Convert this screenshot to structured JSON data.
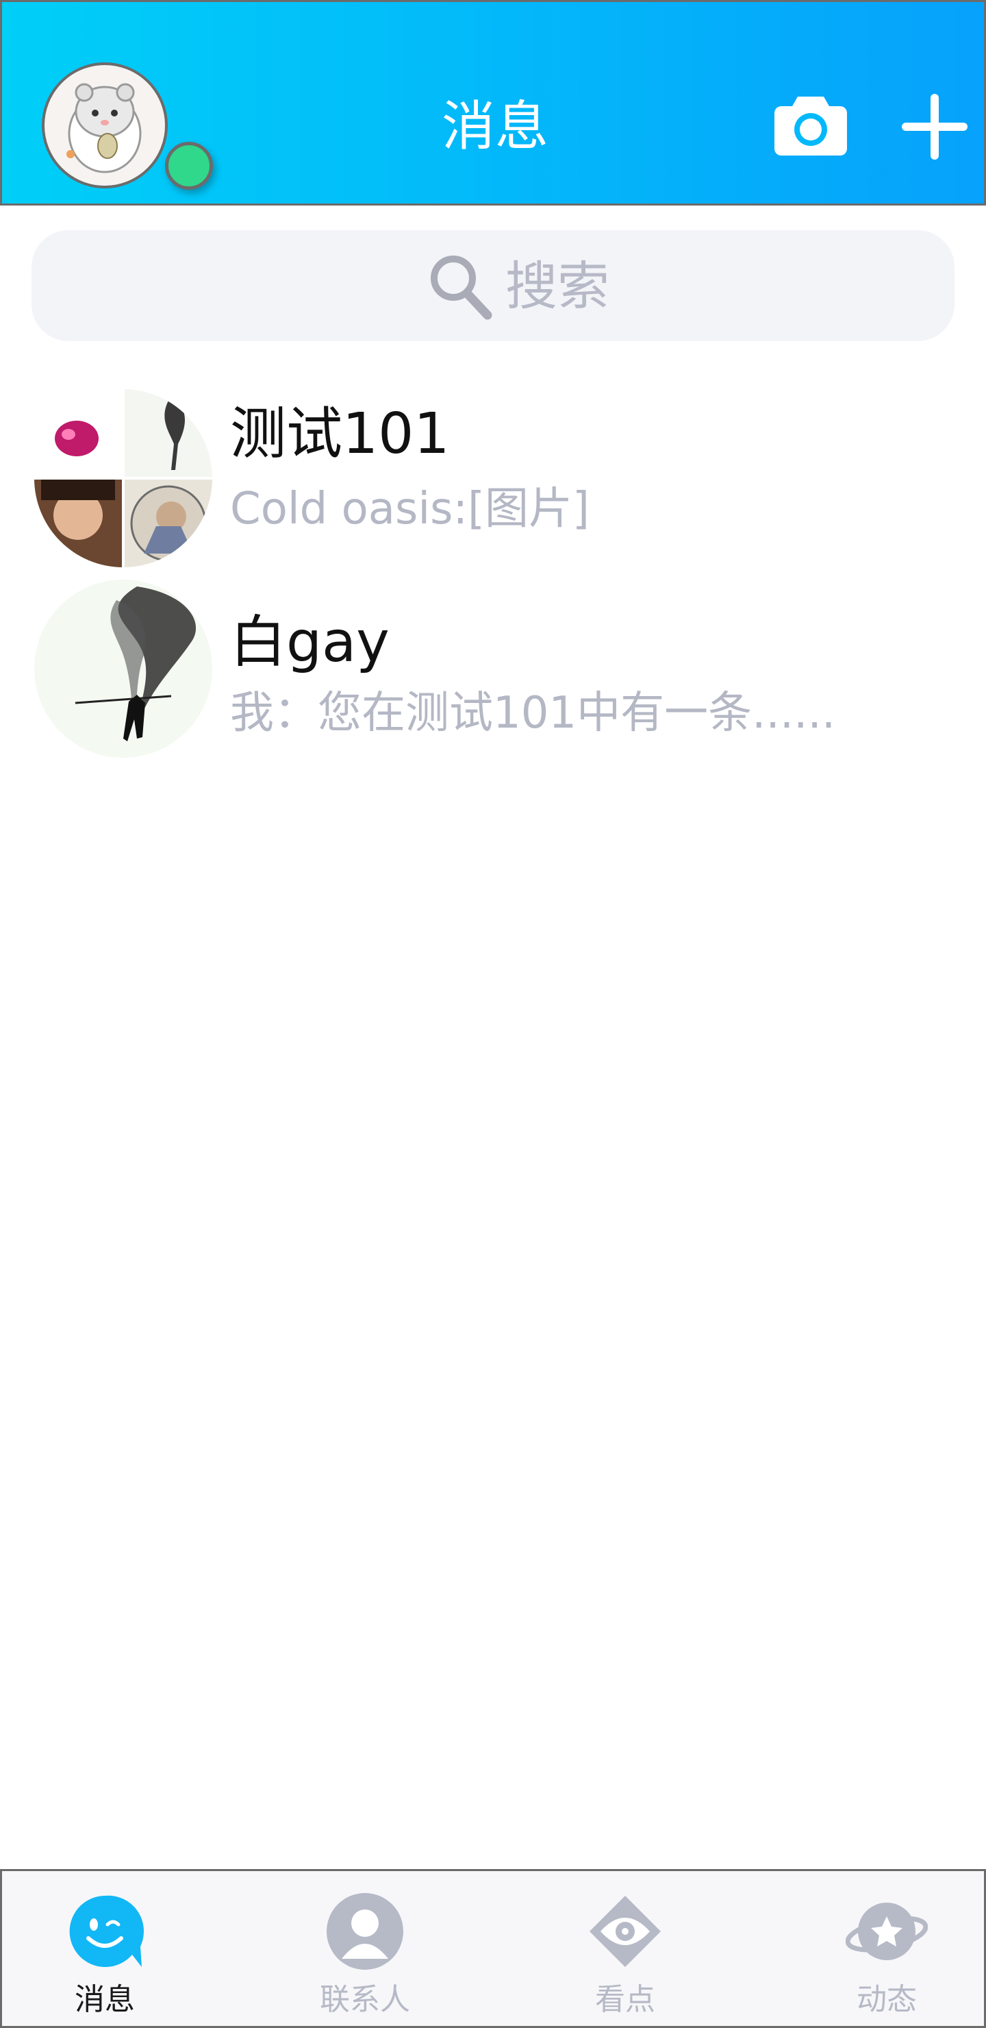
{
  "header": {
    "title": "消息",
    "avatar_icon": "hamster-avatar",
    "status_color": "#2fd88b",
    "camera_icon": "camera-icon",
    "add_icon": "plus-icon",
    "gradient": [
      "#00cff8",
      "#06a2fb"
    ]
  },
  "search": {
    "placeholder": "搜索",
    "icon": "search-icon"
  },
  "conversations": [
    {
      "name": "测试101",
      "preview": "Cold oasis:[图片]",
      "avatar": "group-collage-avatar"
    },
    {
      "name": "白gay",
      "preview": "我：您在测试101中有一条......",
      "avatar": "ink-warrior-avatar"
    }
  ],
  "tabs": [
    {
      "label": "消息",
      "icon": "chat-bubble-icon",
      "active": true
    },
    {
      "label": "联系人",
      "icon": "contact-person-icon",
      "active": false
    },
    {
      "label": "看点",
      "icon": "eye-icon",
      "active": false
    },
    {
      "label": "动态",
      "icon": "planet-star-icon",
      "active": false
    }
  ],
  "colors": {
    "accent": "#12b7f5",
    "inactive": "#b6b9c6",
    "search_bg": "#f3f4f8"
  }
}
